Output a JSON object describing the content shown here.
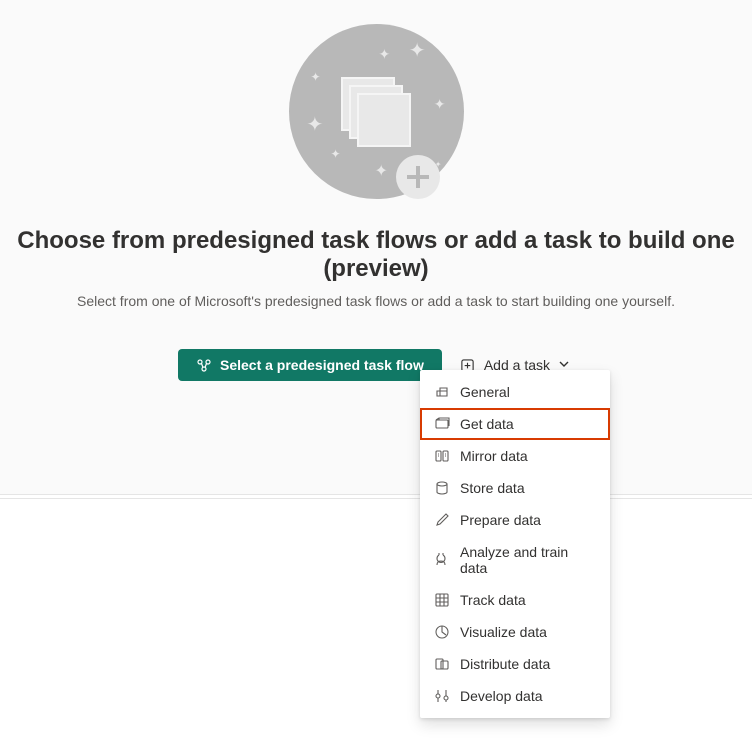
{
  "heading": "Choose from predesigned task flows or add a task to build one (preview)",
  "subtext": "Select from one of Microsoft's predesigned task flows or add a task to start building one yourself.",
  "buttons": {
    "primary": "Select a predesigned task flow",
    "secondary": "Add a task"
  },
  "menu": {
    "items": [
      {
        "label": "General"
      },
      {
        "label": "Get data"
      },
      {
        "label": "Mirror data"
      },
      {
        "label": "Store data"
      },
      {
        "label": "Prepare data"
      },
      {
        "label": "Analyze and train data"
      },
      {
        "label": "Track data"
      },
      {
        "label": "Visualize data"
      },
      {
        "label": "Distribute data"
      },
      {
        "label": "Develop data"
      }
    ],
    "highlighted_index": 1
  }
}
